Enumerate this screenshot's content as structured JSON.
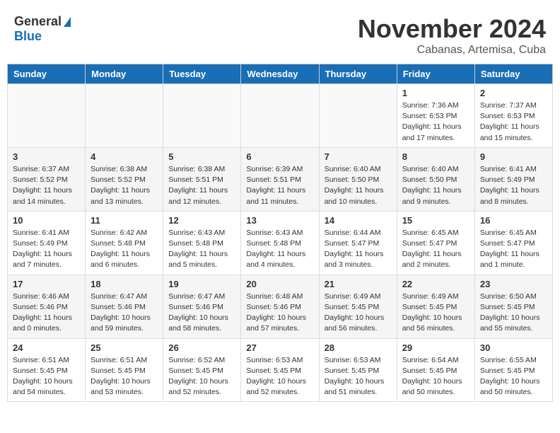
{
  "header": {
    "logo_general": "General",
    "logo_blue": "Blue",
    "month_title": "November 2024",
    "subtitle": "Cabanas, Artemisa, Cuba"
  },
  "days_of_week": [
    "Sunday",
    "Monday",
    "Tuesday",
    "Wednesday",
    "Thursday",
    "Friday",
    "Saturday"
  ],
  "weeks": [
    {
      "days": [
        {
          "num": "",
          "info": ""
        },
        {
          "num": "",
          "info": ""
        },
        {
          "num": "",
          "info": ""
        },
        {
          "num": "",
          "info": ""
        },
        {
          "num": "",
          "info": ""
        },
        {
          "num": "1",
          "info": "Sunrise: 7:36 AM\nSunset: 6:53 PM\nDaylight: 11 hours and 17 minutes."
        },
        {
          "num": "2",
          "info": "Sunrise: 7:37 AM\nSunset: 6:53 PM\nDaylight: 11 hours and 15 minutes."
        }
      ]
    },
    {
      "days": [
        {
          "num": "3",
          "info": "Sunrise: 6:37 AM\nSunset: 5:52 PM\nDaylight: 11 hours and 14 minutes."
        },
        {
          "num": "4",
          "info": "Sunrise: 6:38 AM\nSunset: 5:52 PM\nDaylight: 11 hours and 13 minutes."
        },
        {
          "num": "5",
          "info": "Sunrise: 6:38 AM\nSunset: 5:51 PM\nDaylight: 11 hours and 12 minutes."
        },
        {
          "num": "6",
          "info": "Sunrise: 6:39 AM\nSunset: 5:51 PM\nDaylight: 11 hours and 11 minutes."
        },
        {
          "num": "7",
          "info": "Sunrise: 6:40 AM\nSunset: 5:50 PM\nDaylight: 11 hours and 10 minutes."
        },
        {
          "num": "8",
          "info": "Sunrise: 6:40 AM\nSunset: 5:50 PM\nDaylight: 11 hours and 9 minutes."
        },
        {
          "num": "9",
          "info": "Sunrise: 6:41 AM\nSunset: 5:49 PM\nDaylight: 11 hours and 8 minutes."
        }
      ]
    },
    {
      "days": [
        {
          "num": "10",
          "info": "Sunrise: 6:41 AM\nSunset: 5:49 PM\nDaylight: 11 hours and 7 minutes."
        },
        {
          "num": "11",
          "info": "Sunrise: 6:42 AM\nSunset: 5:48 PM\nDaylight: 11 hours and 6 minutes."
        },
        {
          "num": "12",
          "info": "Sunrise: 6:43 AM\nSunset: 5:48 PM\nDaylight: 11 hours and 5 minutes."
        },
        {
          "num": "13",
          "info": "Sunrise: 6:43 AM\nSunset: 5:48 PM\nDaylight: 11 hours and 4 minutes."
        },
        {
          "num": "14",
          "info": "Sunrise: 6:44 AM\nSunset: 5:47 PM\nDaylight: 11 hours and 3 minutes."
        },
        {
          "num": "15",
          "info": "Sunrise: 6:45 AM\nSunset: 5:47 PM\nDaylight: 11 hours and 2 minutes."
        },
        {
          "num": "16",
          "info": "Sunrise: 6:45 AM\nSunset: 5:47 PM\nDaylight: 11 hours and 1 minute."
        }
      ]
    },
    {
      "days": [
        {
          "num": "17",
          "info": "Sunrise: 6:46 AM\nSunset: 5:46 PM\nDaylight: 11 hours and 0 minutes."
        },
        {
          "num": "18",
          "info": "Sunrise: 6:47 AM\nSunset: 5:46 PM\nDaylight: 10 hours and 59 minutes."
        },
        {
          "num": "19",
          "info": "Sunrise: 6:47 AM\nSunset: 5:46 PM\nDaylight: 10 hours and 58 minutes."
        },
        {
          "num": "20",
          "info": "Sunrise: 6:48 AM\nSunset: 5:46 PM\nDaylight: 10 hours and 57 minutes."
        },
        {
          "num": "21",
          "info": "Sunrise: 6:49 AM\nSunset: 5:45 PM\nDaylight: 10 hours and 56 minutes."
        },
        {
          "num": "22",
          "info": "Sunrise: 6:49 AM\nSunset: 5:45 PM\nDaylight: 10 hours and 56 minutes."
        },
        {
          "num": "23",
          "info": "Sunrise: 6:50 AM\nSunset: 5:45 PM\nDaylight: 10 hours and 55 minutes."
        }
      ]
    },
    {
      "days": [
        {
          "num": "24",
          "info": "Sunrise: 6:51 AM\nSunset: 5:45 PM\nDaylight: 10 hours and 54 minutes."
        },
        {
          "num": "25",
          "info": "Sunrise: 6:51 AM\nSunset: 5:45 PM\nDaylight: 10 hours and 53 minutes."
        },
        {
          "num": "26",
          "info": "Sunrise: 6:52 AM\nSunset: 5:45 PM\nDaylight: 10 hours and 52 minutes."
        },
        {
          "num": "27",
          "info": "Sunrise: 6:53 AM\nSunset: 5:45 PM\nDaylight: 10 hours and 52 minutes."
        },
        {
          "num": "28",
          "info": "Sunrise: 6:53 AM\nSunset: 5:45 PM\nDaylight: 10 hours and 51 minutes."
        },
        {
          "num": "29",
          "info": "Sunrise: 6:54 AM\nSunset: 5:45 PM\nDaylight: 10 hours and 50 minutes."
        },
        {
          "num": "30",
          "info": "Sunrise: 6:55 AM\nSunset: 5:45 PM\nDaylight: 10 hours and 50 minutes."
        }
      ]
    }
  ]
}
